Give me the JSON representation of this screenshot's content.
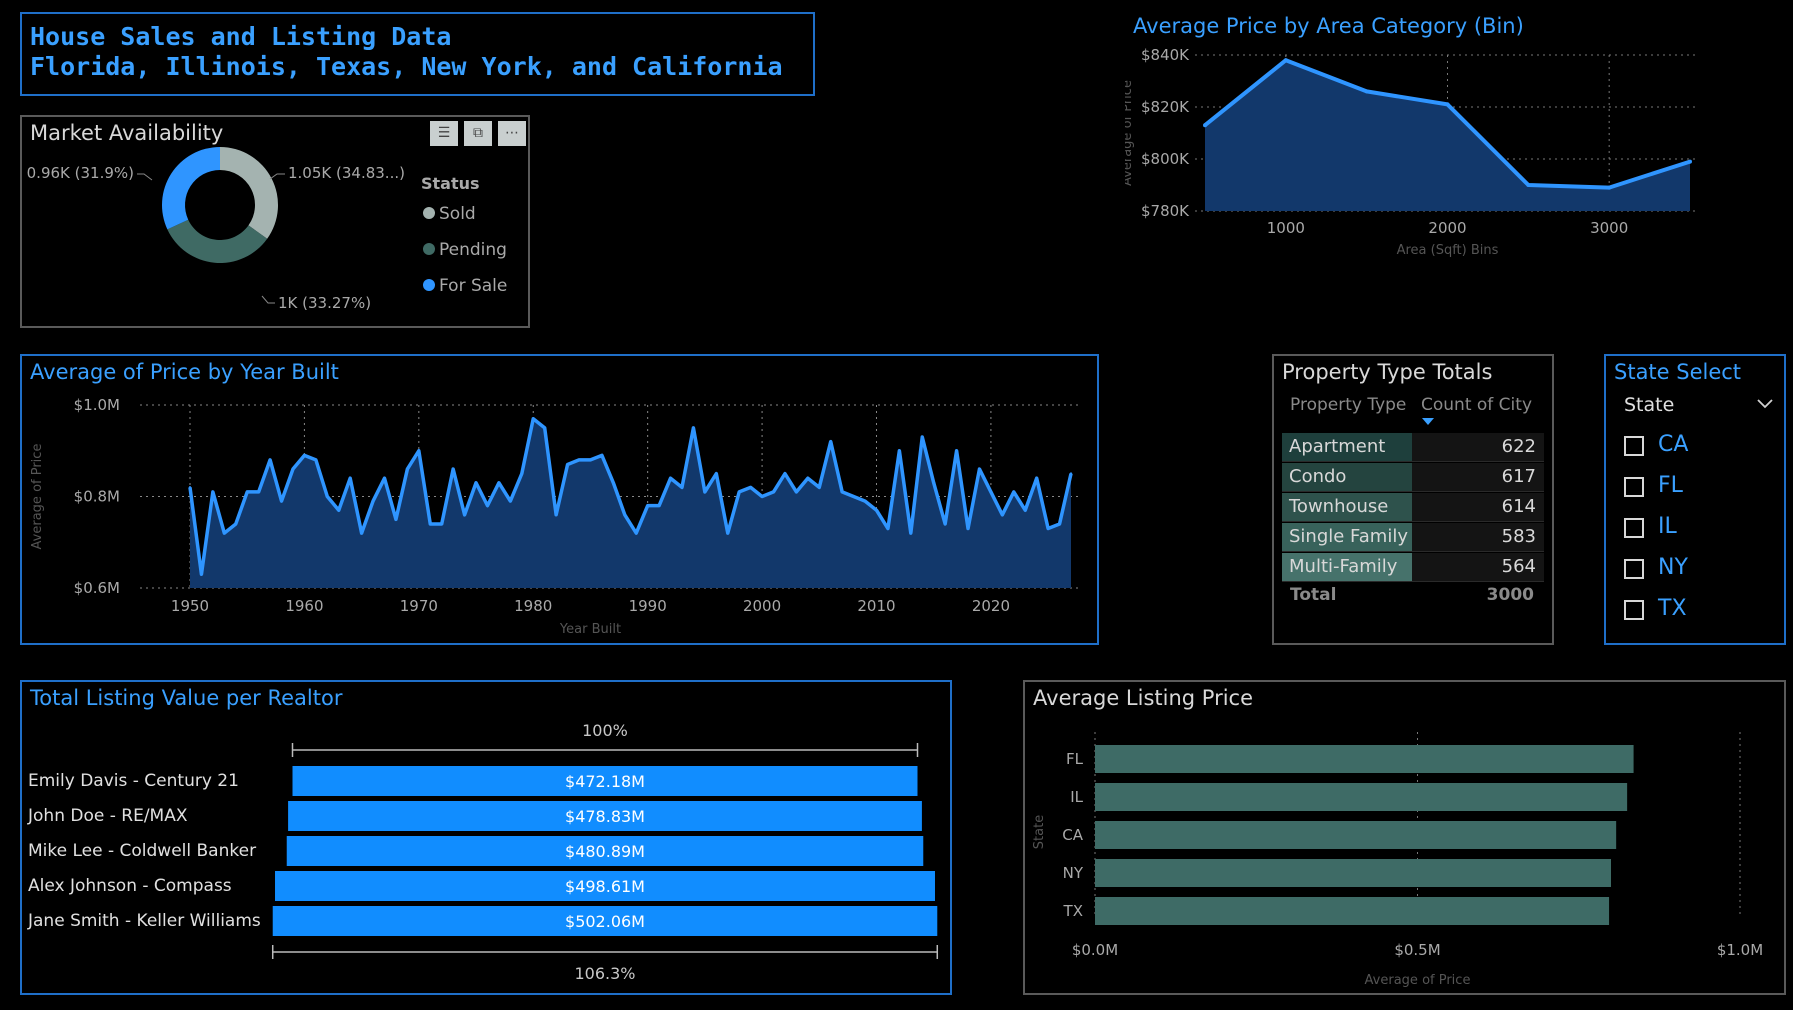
{
  "header": {
    "line1": "House Sales and Listing Data",
    "line2": "Florida, Illinois, Texas, New York, and California"
  },
  "market": {
    "title": "Market Availability",
    "legend_title": "Status",
    "slices": [
      {
        "name": "Sold",
        "value": 1.05,
        "label": "1.05K (34.83...)",
        "color": "#a4b3b0"
      },
      {
        "name": "Pending",
        "value": 1.0,
        "label": "1K (33.27%)",
        "color": "#3f6a64"
      },
      {
        "name": "For Sale",
        "value": 0.96,
        "label": "0.96K (31.9%)",
        "color": "#2f95ff"
      }
    ],
    "toolbar": {
      "filter": "filter-icon",
      "focus": "focus-mode-icon",
      "more": "more-options-icon"
    }
  },
  "area_chart": {
    "title": "Average Price by Area Category (Bin)",
    "chart_data": {
      "type": "area",
      "xlabel": "Area (Sqft) Bins",
      "ylabel": "Average of Price",
      "x": [
        500,
        1000,
        1500,
        2000,
        2500,
        3000,
        3500
      ],
      "values": [
        813,
        838,
        826,
        821,
        790,
        789,
        799
      ],
      "ylim": [
        780,
        840
      ],
      "yticks": [
        "$840K",
        "$820K",
        "$800K",
        "$780K"
      ],
      "xticks": [
        "1000",
        "2000",
        "3000"
      ],
      "color": "#2f95ff"
    }
  },
  "year_chart": {
    "title": "Average of Price by Year Built",
    "chart_data": {
      "type": "area",
      "xlabel": "Year Built",
      "ylabel": "Average of Price",
      "x_start": 1950,
      "values": [
        0.82,
        0.63,
        0.81,
        0.72,
        0.74,
        0.81,
        0.81,
        0.88,
        0.79,
        0.86,
        0.89,
        0.88,
        0.8,
        0.77,
        0.84,
        0.72,
        0.79,
        0.84,
        0.75,
        0.86,
        0.9,
        0.74,
        0.74,
        0.86,
        0.76,
        0.83,
        0.78,
        0.83,
        0.79,
        0.85,
        0.97,
        0.95,
        0.76,
        0.87,
        0.88,
        0.88,
        0.89,
        0.83,
        0.76,
        0.72,
        0.78,
        0.78,
        0.84,
        0.82,
        0.95,
        0.81,
        0.85,
        0.72,
        0.81,
        0.82,
        0.8,
        0.81,
        0.85,
        0.81,
        0.84,
        0.82,
        0.92,
        0.81,
        0.8,
        0.79,
        0.77,
        0.73,
        0.9,
        0.72,
        0.93,
        0.83,
        0.74,
        0.9,
        0.73,
        0.86,
        0.81,
        0.76,
        0.81,
        0.77,
        0.84,
        0.73,
        0.74,
        0.85
      ],
      "ylim": [
        0.6,
        1.0
      ],
      "yticks": [
        "$1.0M",
        "$0.8M",
        "$0.6M"
      ],
      "xticks": [
        "1950",
        "1960",
        "1970",
        "1980",
        "1990",
        "2000",
        "2010",
        "2020"
      ],
      "color": "#2f95ff"
    }
  },
  "property_table": {
    "title": "Property Type Totals",
    "col1": "Property Type",
    "col2": "Count of City",
    "sort_icon": "sort-desc-icon",
    "rows": [
      {
        "type": "Apartment",
        "count": "622"
      },
      {
        "type": "Condo",
        "count": "617"
      },
      {
        "type": "Townhouse",
        "count": "614"
      },
      {
        "type": "Single Family",
        "count": "583"
      },
      {
        "type": "Multi-Family",
        "count": "564"
      }
    ],
    "total_label": "Total",
    "total_value": "3000"
  },
  "state_select": {
    "title": "State Select",
    "field": "State",
    "options": [
      "CA",
      "FL",
      "IL",
      "NY",
      "TX"
    ]
  },
  "realtor_chart": {
    "title": "Total Listing Value per Realtor",
    "top_pct": "100%",
    "bottom_pct": "106.3%",
    "chart_data": {
      "type": "bar",
      "categories": [
        "Emily Davis - Century 21",
        "John Doe - RE/MAX",
        "Mike Lee - Coldwell Banker",
        "Alex Johnson - Compass",
        "Jane Smith - Keller Williams"
      ],
      "values": [
        472.18,
        478.83,
        480.89,
        498.61,
        502.06
      ],
      "labels": [
        "$472.18M",
        "$478.83M",
        "$480.89M",
        "$498.61M",
        "$502.06M"
      ],
      "color": "#118dff"
    }
  },
  "listing_chart": {
    "title": "Average Listing Price",
    "chart_data": {
      "type": "bar",
      "categories": [
        "FL",
        "IL",
        "CA",
        "NY",
        "TX"
      ],
      "values": [
        0.835,
        0.825,
        0.808,
        0.8,
        0.797
      ],
      "xlim": [
        0,
        1.0
      ],
      "xticks": [
        "$0.0M",
        "$0.5M",
        "$1.0M"
      ],
      "xlabel": "Average of Price",
      "ylabel": "State",
      "color": "#3e6b66"
    }
  }
}
